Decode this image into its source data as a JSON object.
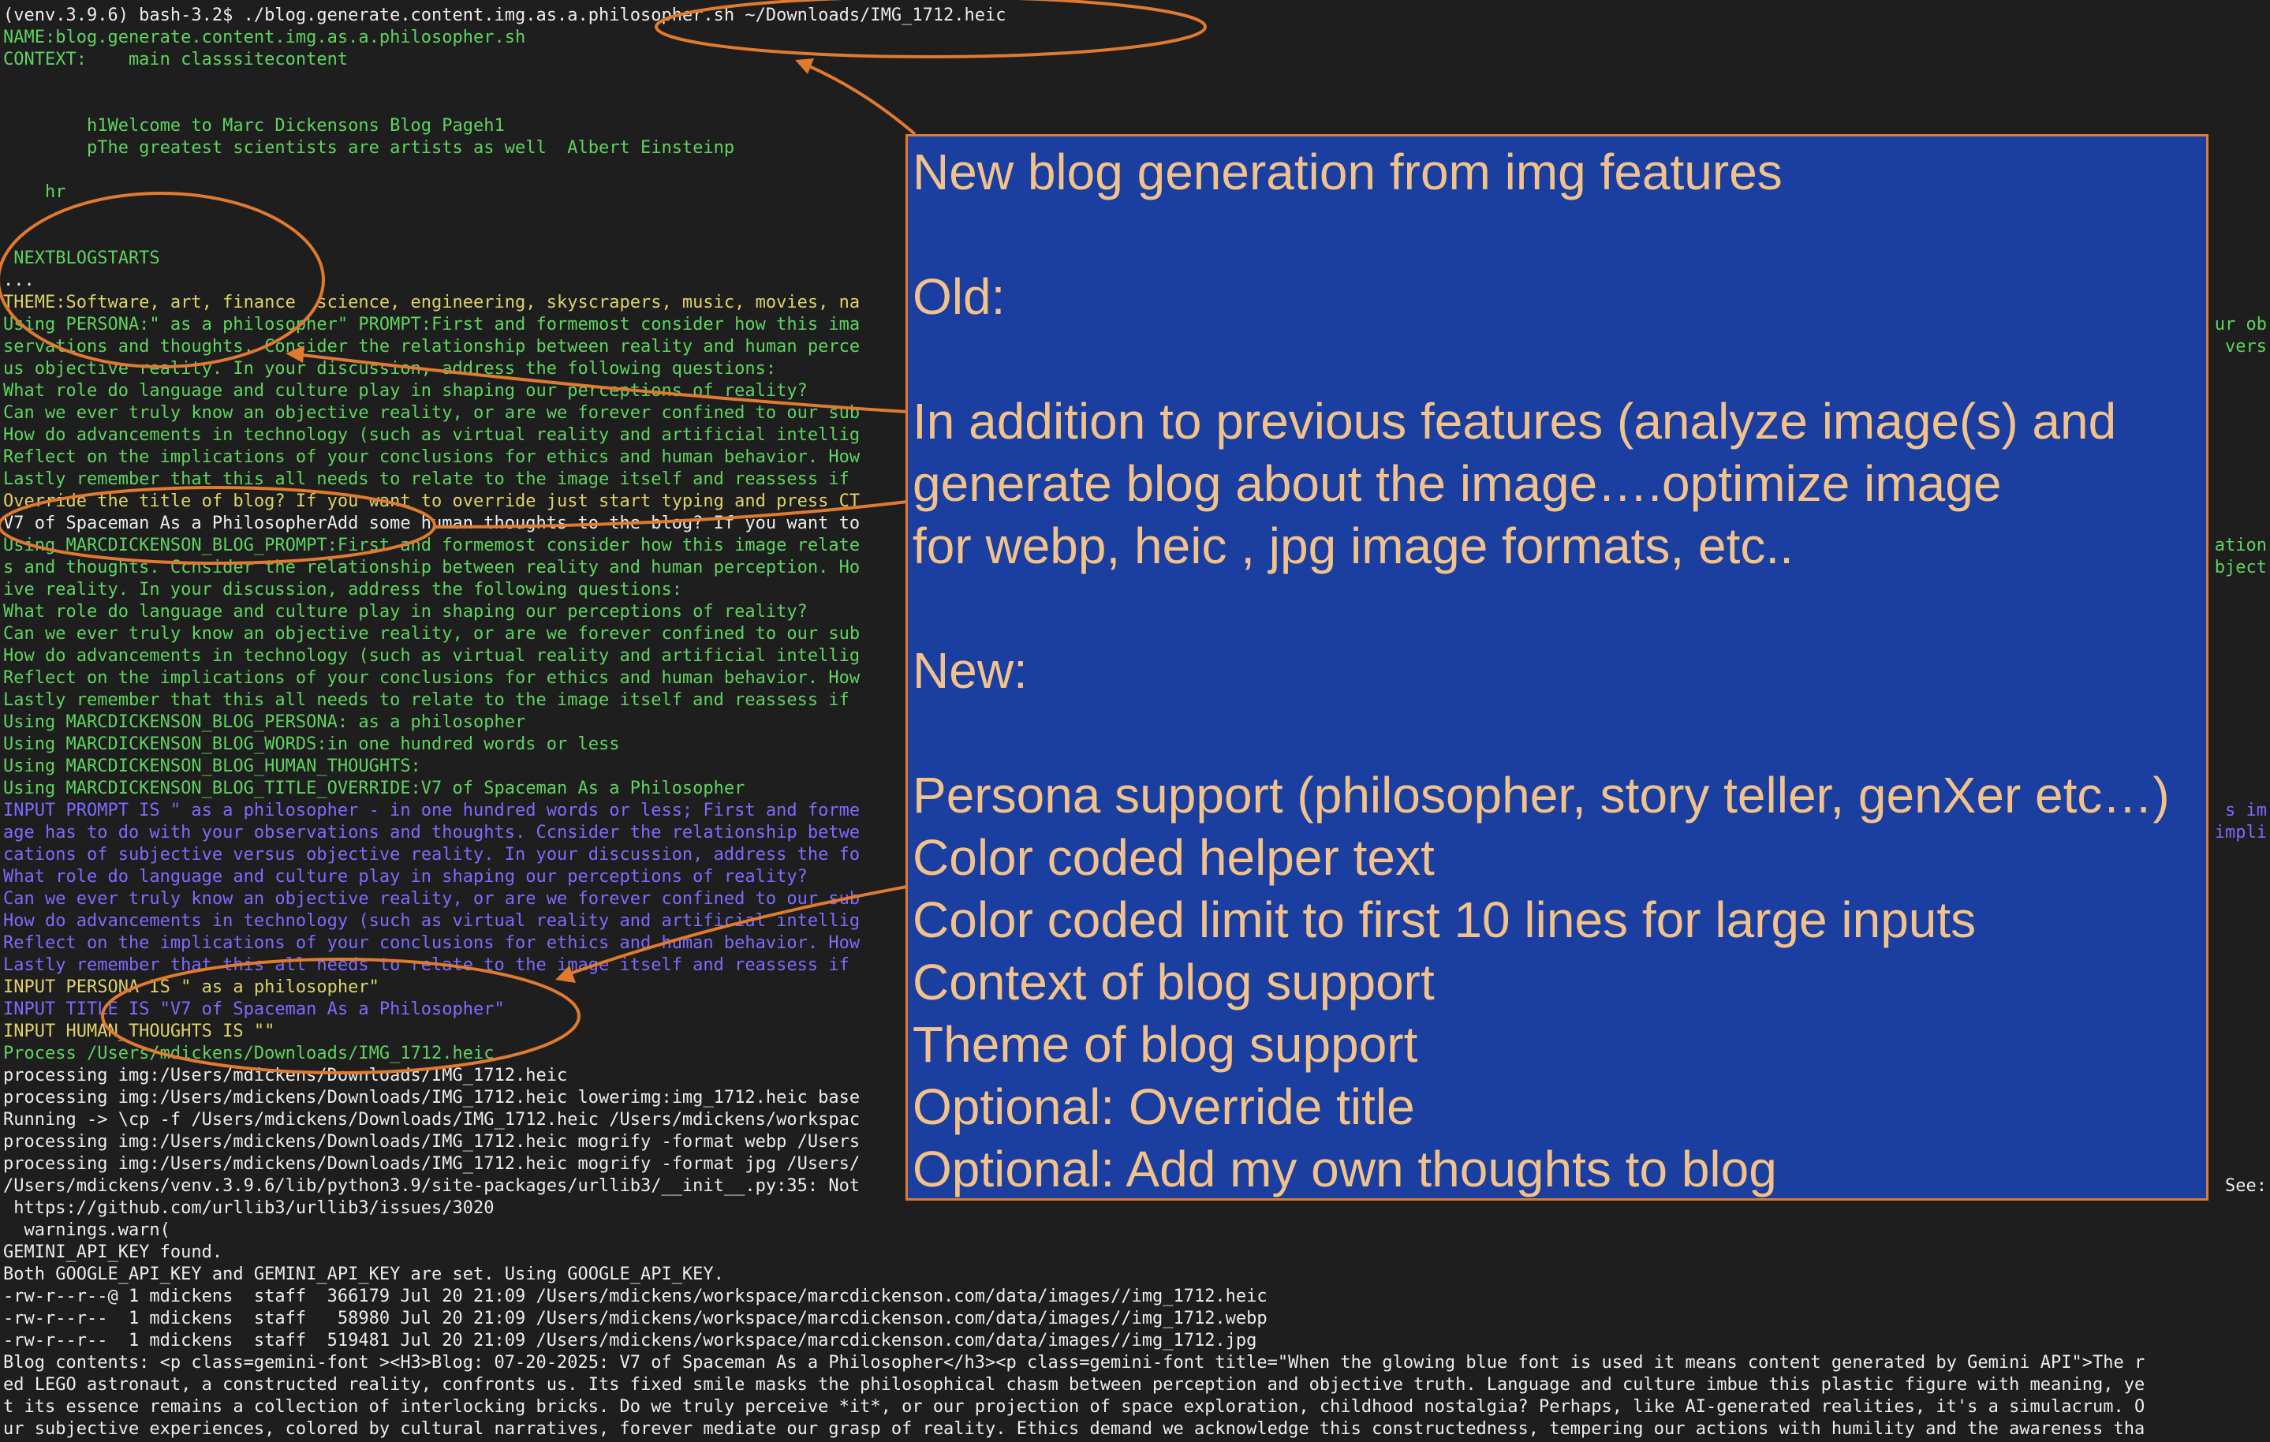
{
  "terminal": {
    "lines": [
      {
        "text": "(venv.3.9.6) bash-3.2$ ./blog.generate.content.img.as.a.philosopher.sh ~/Downloads/IMG_1712.heic",
        "color": "#ececec"
      },
      {
        "text": "NAME:blog.generate.content.img.as.a.philosopher.sh",
        "color": "#5fd35f"
      },
      {
        "text": "CONTEXT:    main classsitecontent",
        "color": "#5fd35f"
      },
      {
        "text": "",
        "color": "#5fd35f"
      },
      {
        "text": "",
        "color": "#5fd35f"
      },
      {
        "text": "        h1Welcome to Marc Dickensons Blog Pageh1",
        "color": "#5fd35f"
      },
      {
        "text": "        pThe greatest scientists are artists as well  Albert Einsteinp",
        "color": "#5fd35f"
      },
      {
        "text": "",
        "color": "#5fd35f"
      },
      {
        "text": "    hr",
        "color": "#5fd35f"
      },
      {
        "text": "",
        "color": "#5fd35f"
      },
      {
        "text": "",
        "color": "#5fd35f"
      },
      {
        "text": " NEXTBLOGSTARTS",
        "color": "#5fd35f"
      },
      {
        "text": "...",
        "color": "#ececec"
      },
      {
        "text": "THEME:Software, art, finance  science, engineering, skyscrapers, music, movies, na",
        "color": "#dfd16a"
      },
      {
        "text": "Using PERSONA:\" as a philosopher\" PROMPT:First and formemost consider how this ima",
        "color": "#5fd35f"
      },
      {
        "text": "servations and thoughts. Consider the relationship between reality and human perce",
        "color": "#5fd35f"
      },
      {
        "text": "us objective reality. In your discussion, address the following questions:",
        "color": "#5fd35f"
      },
      {
        "text": "What role do language and culture play in shaping our perceptions of reality?",
        "color": "#5fd35f"
      },
      {
        "text": "Can we ever truly know an objective reality, or are we forever confined to our sub",
        "color": "#5fd35f"
      },
      {
        "text": "How do advancements in technology (such as virtual reality and artificial intellig",
        "color": "#5fd35f"
      },
      {
        "text": "Reflect on the implications of your conclusions for ethics and human behavior. How",
        "color": "#5fd35f"
      },
      {
        "text": "Lastly remember that this all needs to relate to the image itself and reassess if ",
        "color": "#5fd35f"
      },
      {
        "text": "Override the title of blog? If you want to override just start typing and press CT",
        "color": "#dfd16a"
      },
      {
        "text": "V7 of Spaceman As a PhilosopherAdd some human thoughts to the blog? If you want to ",
        "color": "#ececec"
      },
      {
        "text": "Using MARCDICKENSON_BLOG_PROMPT:First and formemost consider how this image relate",
        "color": "#5fd35f"
      },
      {
        "text": "s and thoughts. Ccnsider the relationship between reality and human perception. Ho",
        "color": "#5fd35f"
      },
      {
        "text": "ive reality. In your discussion, address the following questions:",
        "color": "#5fd35f"
      },
      {
        "text": "What role do language and culture play in shaping our perceptions of reality?",
        "color": "#5fd35f"
      },
      {
        "text": "Can we ever truly know an objective reality, or are we forever confined to our sub",
        "color": "#5fd35f"
      },
      {
        "text": "How do advancements in technology (such as virtual reality and artificial intellig",
        "color": "#5fd35f"
      },
      {
        "text": "Reflect on the implications of your conclusions for ethics and human behavior. How",
        "color": "#5fd35f"
      },
      {
        "text": "Lastly remember that this all needs to relate to the image itself and reassess if ",
        "color": "#5fd35f"
      },
      {
        "text": "Using MARCDICKENSON_BLOG_PERSONA: as a philosopher",
        "color": "#5fd35f"
      },
      {
        "text": "Using MARCDICKENSON_BLOG_WORDS:in one hundred words or less",
        "color": "#5fd35f"
      },
      {
        "text": "Using MARCDICKENSON_BLOG_HUMAN_THOUGHTS:",
        "color": "#5fd35f"
      },
      {
        "text": "Using MARCDICKENSON_BLOG_TITLE_OVERRIDE:V7 of Spaceman As a Philosopher",
        "color": "#5fd35f"
      },
      {
        "text": "INPUT PROMPT IS \" as a philosopher - in one hundred words or less; First and forme",
        "color": "#7d6bff"
      },
      {
        "text": "age has to do with your observations and thoughts. Ccnsider the relationship betwe",
        "color": "#7d6bff"
      },
      {
        "text": "cations of subjective versus objective reality. In your discussion, address the fo",
        "color": "#7d6bff"
      },
      {
        "text": "What role do language and culture play in shaping our perceptions of reality?",
        "color": "#7d6bff"
      },
      {
        "text": "Can we ever truly know an objective reality, or are we forever confined to our sub",
        "color": "#7d6bff"
      },
      {
        "text": "How do advancements in technology (such as virtual reality and artificial intellig",
        "color": "#7d6bff"
      },
      {
        "text": "Reflect on the implications of your conclusions for ethics and human behavior. How",
        "color": "#7d6bff"
      },
      {
        "text": "Lastly remember that this all needs to relate to the image itself and reassess if ",
        "color": "#7d6bff"
      },
      {
        "text": "INPUT PERSONA IS \" as a philosopher\"",
        "color": "#dfd16a"
      },
      {
        "text": "INPUT TITLE IS \"V7 of Spaceman As a Philosopher\"",
        "color": "#7d6bff"
      },
      {
        "text": "INPUT HUMAN_THOUGHTS IS \"\"",
        "color": "#dfd16a"
      },
      {
        "text": "Process /Users/mdickens/Downloads/IMG_1712.heic",
        "color": "#5fd35f"
      },
      {
        "text": "processing img:/Users/mdickens/Downloads/IMG_1712.heic",
        "color": "#ececec"
      },
      {
        "text": "processing img:/Users/mdickens/Downloads/IMG_1712.heic lowerimg:img_1712.heic base",
        "color": "#ececec"
      },
      {
        "text": "Running -> \\cp -f /Users/mdickens/Downloads/IMG_1712.heic /Users/mdickens/workspac",
        "color": "#ececec"
      },
      {
        "text": "processing img:/Users/mdickens/Downloads/IMG_1712.heic mogrify -format webp /Users",
        "color": "#ececec"
      },
      {
        "text": "processing img:/Users/mdickens/Downloads/IMG_1712.heic mogrify -format jpg /Users/",
        "color": "#ececec"
      },
      {
        "text": "/Users/mdickens/venv.3.9.6/lib/python3.9/site-packages/urllib3/__init__.py:35: Not",
        "color": "#ececec"
      },
      {
        "text": " https://github.com/urllib3/urllib3/issues/3020",
        "color": "#ececec"
      },
      {
        "text": "  warnings.warn(",
        "color": "#ececec"
      },
      {
        "text": "GEMINI_API_KEY found.",
        "color": "#ececec"
      },
      {
        "text": "Both GOOGLE_API_KEY and GEMINI_API_KEY are set. Using GOOGLE_API_KEY.",
        "color": "#ececec"
      },
      {
        "text": "-rw-r--r--@ 1 mdickens  staff  366179 Jul 20 21:09 /Users/mdickens/workspace/marcdickenson.com/data/images//img_1712.heic",
        "color": "#ececec"
      },
      {
        "text": "-rw-r--r--  1 mdickens  staff   58980 Jul 20 21:09 /Users/mdickens/workspace/marcdickenson.com/data/images//img_1712.webp",
        "color": "#ececec"
      },
      {
        "text": "-rw-r--r--  1 mdickens  staff  519481 Jul 20 21:09 /Users/mdickens/workspace/marcdickenson.com/data/images//img_1712.jpg",
        "color": "#ececec"
      },
      {
        "text": "Blog contents: <p class=gemini-font ><H3>Blog: 07-20-2025: V7 of Spaceman As a Philosopher</h3><p class=gemini-font title=\"When the glowing blue font is used it means content generated by Gemini API\">The r",
        "color": "#ececec"
      },
      {
        "text": "ed LEGO astronaut, a constructed reality, confronts us. Its fixed smile masks the philosophical chasm between perception and objective truth. Language and culture imbue this plastic figure with meaning, ye",
        "color": "#ececec"
      },
      {
        "text": "t its essence remains a collection of interlocking bricks. Do we truly perceive *it*, or our projection of space exploration, childhood nostalgia? Perhaps, like AI-generated realities, it's a simulacrum. O",
        "color": "#ececec"
      },
      {
        "text": "ur subjective experiences, colored by cultural narratives, forever mediate our grasp of reality. Ethics demand we acknowledge this constructedness, tempering our actions with humility and the awareness tha",
        "color": "#ececec"
      }
    ],
    "right_fragments": [
      {
        "line": 14,
        "text": "ur ob",
        "color": "#5fd35f"
      },
      {
        "line": 15,
        "text": "vers",
        "color": "#5fd35f"
      },
      {
        "line": 24,
        "text": "ation",
        "color": "#5fd35f"
      },
      {
        "line": 25,
        "text": "bject",
        "color": "#5fd35f"
      },
      {
        "line": 36,
        "text": "s im",
        "color": "#7d6bff"
      },
      {
        "line": 37,
        "text": "impli",
        "color": "#7d6bff"
      },
      {
        "line": 53,
        "text": "See:",
        "color": "#ececec"
      }
    ]
  },
  "overlay": {
    "lines": [
      "New blog generation from img features",
      "",
      "Old:",
      "",
      "In addition to previous features (analyze image(s) and",
      "generate blog about the image….optimize image",
      "for webp, heic , jpg image formats, etc..",
      "",
      "New:",
      "",
      "Persona support (philosopher, story teller, genXer etc…)",
      "Color coded helper text",
      "Color coded limit to first 10 lines for large inputs",
      "Context of blog support",
      "Theme of blog support",
      "Optional: Override title",
      "Optional: Add my own thoughts to blog"
    ],
    "background": "#1a3fa0",
    "border": "#e07a2f",
    "text_color": "#f2c28a"
  },
  "annotation_color": "#e07a2f"
}
